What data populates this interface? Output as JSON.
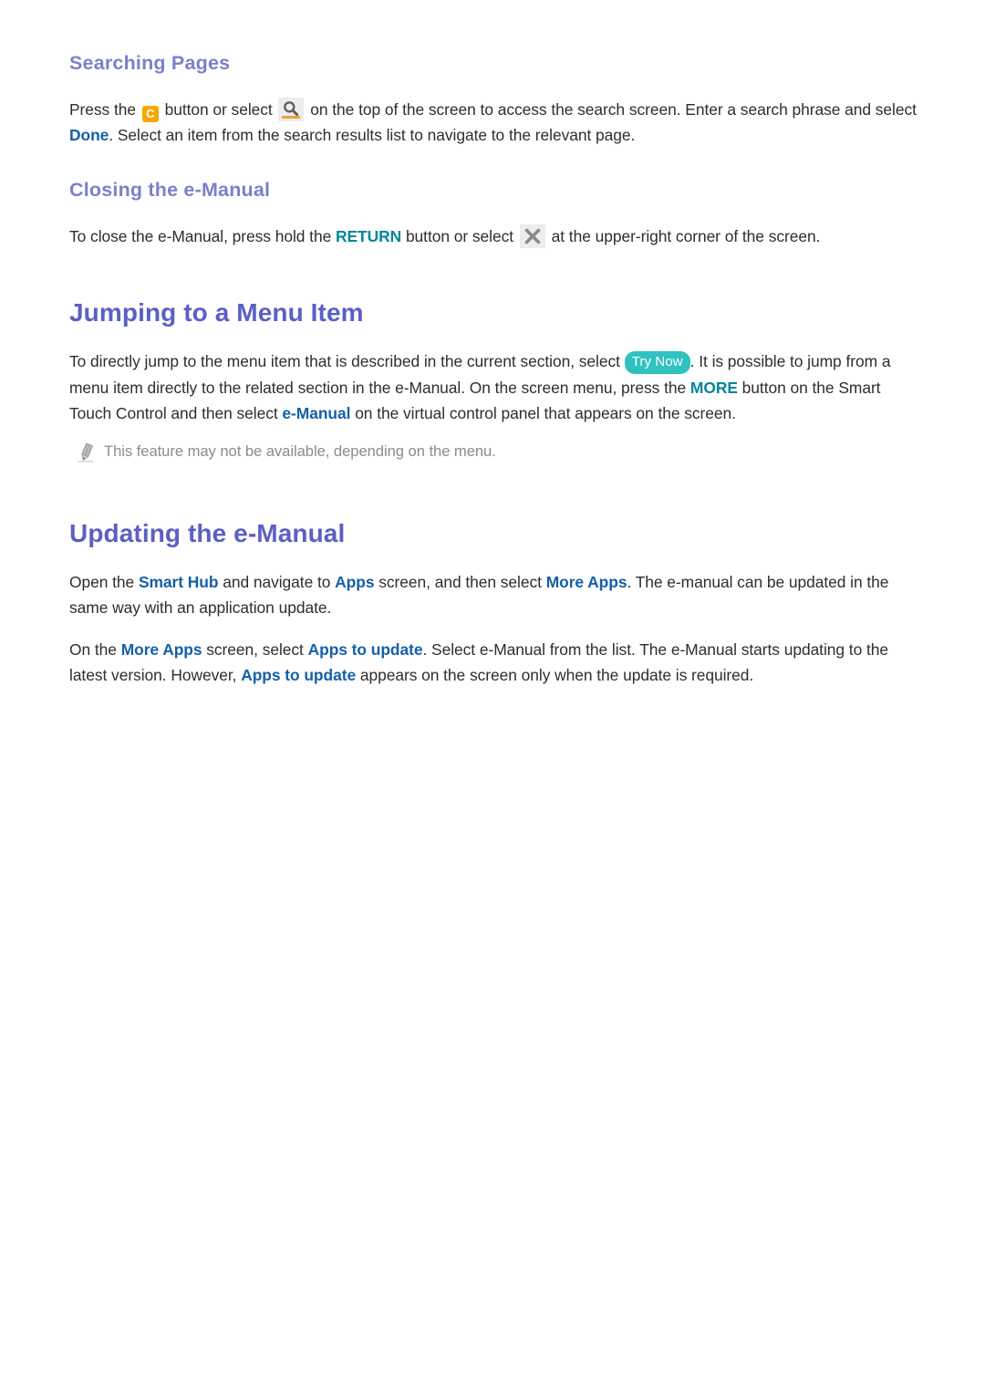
{
  "page": {
    "background_color": "#ffffff",
    "text_color": "#2e2e2e"
  },
  "colors": {
    "sub_heading": "#7b80c8",
    "main_heading": "#5a60c4",
    "link_blue": "#1560a8",
    "link_teal": "#00879c",
    "try_now_badge": "#2fc2c0",
    "color_button_c": "#f5a800",
    "icon_chip_bg": "#ededed",
    "note_text": "#8b8b8b"
  },
  "sections": {
    "searching_pages": {
      "heading": "Searching Pages",
      "paragraph": {
        "part1": "Press the ",
        "c_button_label": "C",
        "part2": " button or select ",
        "search_icon_name": "search-icon",
        "part3": " on the top of the screen to access the search screen. Enter a search phrase and select ",
        "link_done": "Done",
        "part4": ". Select an item from the search results list to navigate to the relevant page."
      }
    },
    "closing_the_emanual": {
      "heading": "Closing the e-Manual",
      "paragraph": {
        "part1": "To close the e-Manual, press hold the ",
        "link_return": "RETURN",
        "part2": " button or select ",
        "close_icon_name": "close-icon",
        "part3": " at the upper-right corner of the screen."
      }
    },
    "jumping_to_a_menu_item": {
      "heading": "Jumping to a Menu Item",
      "paragraph": {
        "part1": "To directly jump to the menu item that is described in the current section, select ",
        "badge_try_now": "Try Now",
        "part2": ". It is possible to jump from a menu item directly to the related section in the e-Manual. On the screen menu, press the ",
        "link_more": "MORE",
        "part3": " button on the Smart Touch Control and then select ",
        "link_emanual": "e-Manual",
        "part4": " on the virtual control panel that appears on the screen."
      },
      "note": {
        "icon_name": "pencil-note-icon",
        "text": "This feature may not be available, depending on the menu."
      }
    },
    "updating_the_emanual": {
      "heading": "Updating the e-Manual",
      "paragraph1": {
        "part1": "Open the ",
        "link_smart_hub": "Smart Hub",
        "part2": " and navigate to ",
        "link_apps": "Apps",
        "part3": " screen, and then select ",
        "link_more_apps": "More Apps",
        "part4": ". The e-manual can be updated in the same way with an application update."
      },
      "paragraph2": {
        "part1": "On the ",
        "link_more_apps": "More Apps",
        "part2": " screen, select ",
        "link_apps_to_update": "Apps to update",
        "part3": ". Select e-Manual from the list. The e-Manual starts updating to the latest version. However, ",
        "link_apps_to_update_2": "Apps to update",
        "part4": " appears on the screen only when the update is required."
      }
    }
  }
}
